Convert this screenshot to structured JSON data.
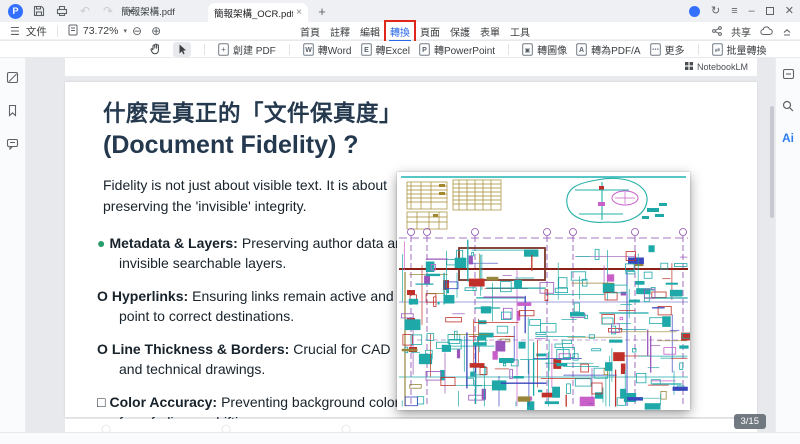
{
  "titlebar": {
    "tab1": "簡報架構.pdf",
    "tab2": "簡報架構_OCR.pdf *",
    "close_glyph": "×",
    "add_glyph": "+"
  },
  "menubar": {
    "file": "文件",
    "zoom": "73.72%",
    "tabs": [
      "首頁",
      "註釋",
      "編輯",
      "轉換",
      "頁面",
      "保護",
      "表單",
      "工具"
    ],
    "active_tab": "轉換",
    "share": "共享"
  },
  "toolbar": {
    "items": [
      {
        "label": "創建 PDF",
        "glyph": "+"
      },
      {
        "label": "轉Word",
        "glyph": "W"
      },
      {
        "label": "轉Excel",
        "glyph": "E"
      },
      {
        "label": "轉PowerPoint",
        "glyph": "P"
      },
      {
        "label": "轉圖像",
        "glyph": "▣"
      },
      {
        "label": "轉為PDF/A",
        "glyph": "A"
      },
      {
        "label": "更多",
        "glyph": "⋯"
      },
      {
        "label": "批量轉換",
        "glyph": "⇄"
      }
    ]
  },
  "rails": {
    "ai": "Ai"
  },
  "document": {
    "notebooklm": "NotebookLM",
    "page_indicator": "3/15"
  },
  "slide": {
    "title_zh": "什麼是真正的「文件保真度」",
    "title_en": "(Document Fidelity) ?",
    "intro": "Fidelity is not just about visible text. It is about preserving the 'invisible' integrity.",
    "bullets": [
      {
        "prefix": "●",
        "label": "Metadata & Layers:",
        "text": "Preserving author data and invisible searchable layers."
      },
      {
        "prefix": "O",
        "label": "Hyperlinks:",
        "text": "Ensuring links remain active and point to correct destinations."
      },
      {
        "prefix": "O",
        "label": "Line Thickness & Borders:",
        "text": "Crucial for CAD and technical drawings."
      },
      {
        "prefix": "□",
        "label": "Color Accuracy:",
        "text": "Preventing background colors from fading or shifting."
      }
    ]
  },
  "colors": {
    "accent": "#2a6ae9",
    "annotation_red": "#e0271c",
    "bullet_green": "#2a9d6f",
    "title": "#24384e",
    "badge_bg": "#5f6770"
  },
  "cad": {
    "palette": [
      "#1fa8a8",
      "#c03028",
      "#9a55bb",
      "#3a46bd",
      "#98863a",
      "#c95fc9"
    ]
  }
}
